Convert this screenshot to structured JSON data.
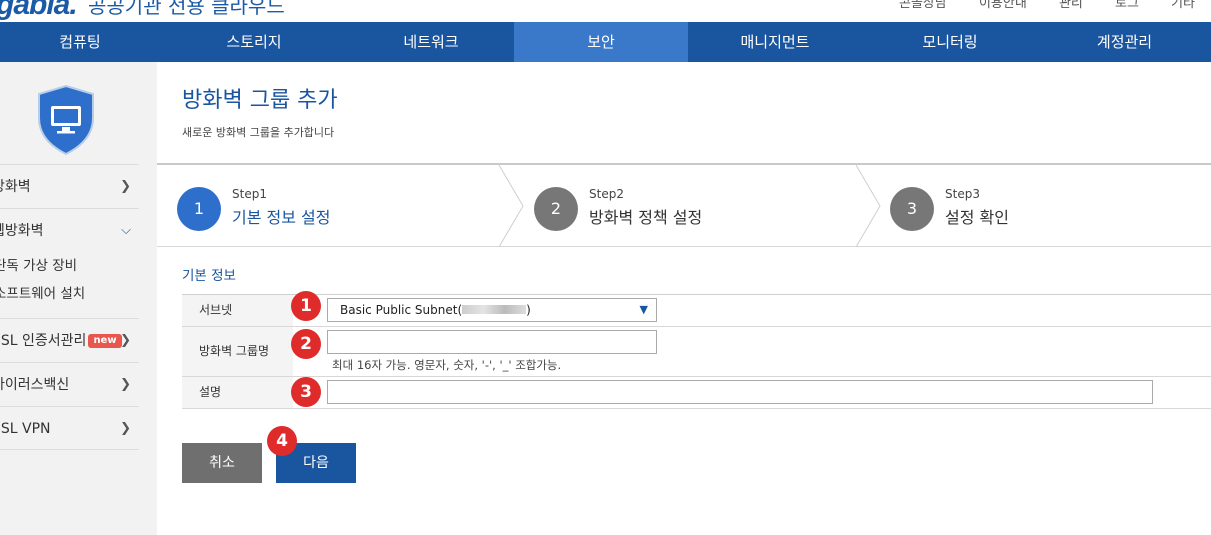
{
  "header": {
    "logo": "gabia.",
    "service_name": "공공기관 전용 클라우드",
    "top_links": [
      "콘솔상담",
      "이용안내",
      "관리",
      "로그",
      "기타"
    ]
  },
  "nav": {
    "items": [
      "컴퓨팅",
      "스토리지",
      "네트워크",
      "보안",
      "매니지먼트",
      "모니터링",
      "계정관리"
    ],
    "active_index": 3
  },
  "sidebar": {
    "icon": "shield-monitor-icon",
    "items": [
      {
        "label": "방화벽",
        "expanded": false
      },
      {
        "label": "웹방화벽",
        "expanded": true,
        "children": [
          "단독 가상 장비",
          "소프트웨어 설치"
        ]
      },
      {
        "label": "SSL 인증서관리",
        "badge": "new",
        "expanded": false
      },
      {
        "label": "바이러스백신",
        "expanded": false
      },
      {
        "label": "SSL VPN",
        "expanded": false
      }
    ]
  },
  "page": {
    "title": "방화벽 그룹 추가",
    "description": "새로운 방화벽 그룹을 추가합니다"
  },
  "steps": [
    {
      "number": "1",
      "small": "Step1",
      "label": "기본 정보 설정",
      "active": true
    },
    {
      "number": "2",
      "small": "Step2",
      "label": "방화벽 정책 설정",
      "active": false
    },
    {
      "number": "3",
      "small": "Step3",
      "label": "설정 확인",
      "active": false
    }
  ],
  "form": {
    "section_title": "기본 정보",
    "subnet": {
      "label": "서브넷",
      "marker": "1",
      "value_prefix": "Basic Public Subnet(",
      "value_suffix": ")"
    },
    "group_name": {
      "label": "방화벽 그룹명",
      "marker": "2",
      "value": "",
      "hint": "최대 16자 가능. 영문자, 숫자, '-', '_' 조합가능."
    },
    "description": {
      "label": "설명",
      "marker": "3",
      "value": ""
    }
  },
  "buttons": {
    "cancel": "취소",
    "next": "다음",
    "marker": "4"
  },
  "colors": {
    "nav_bg": "#1a56a0",
    "nav_active": "#3a78c9",
    "marker_red": "#e02b2b",
    "step_active": "#2e6fcb"
  }
}
